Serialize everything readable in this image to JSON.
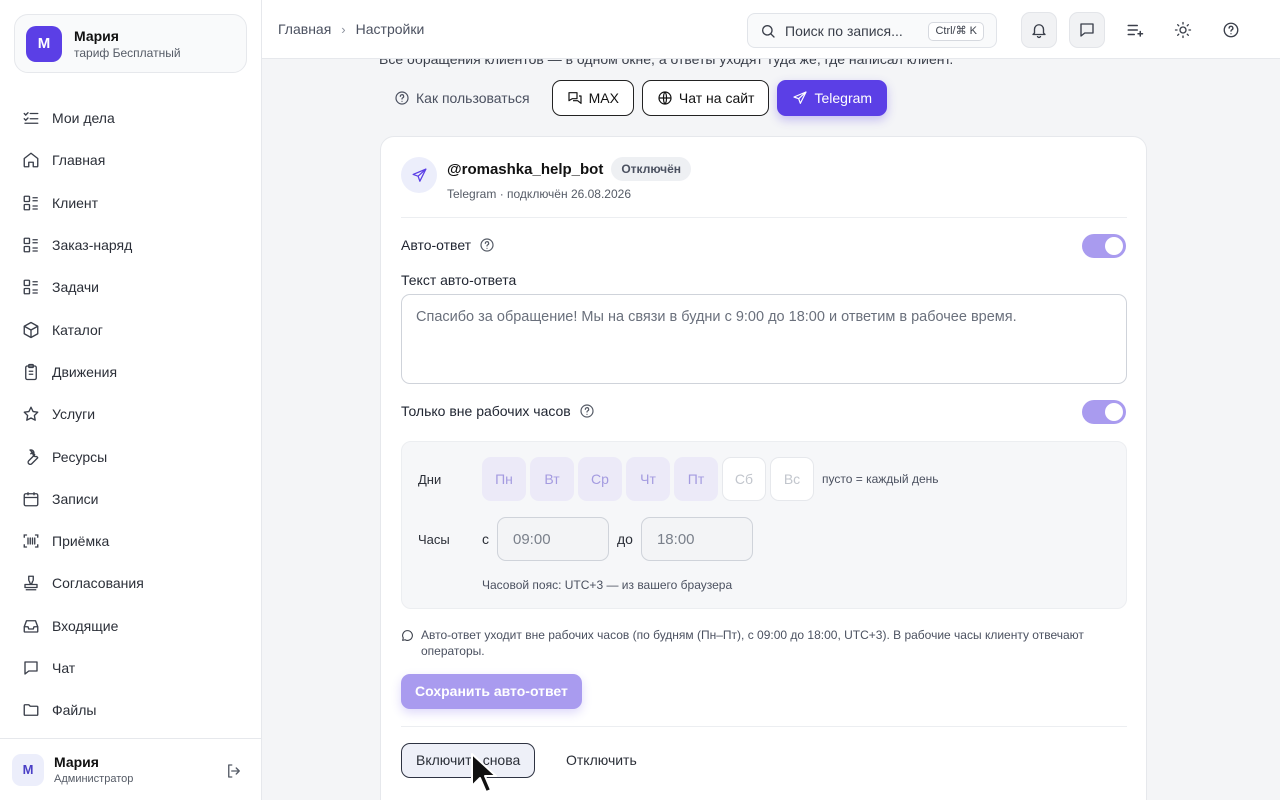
{
  "account": {
    "initial": "М",
    "name": "Мария",
    "plan": "тариф Бесплатный"
  },
  "nav": [
    {
      "label": "Мои дела",
      "icon": "checklist-icon"
    },
    {
      "label": "Главная",
      "icon": "home-icon"
    },
    {
      "label": "Клиент",
      "icon": "list-icon"
    },
    {
      "label": "Заказ-наряд",
      "icon": "list-icon"
    },
    {
      "label": "Задачи",
      "icon": "list-icon"
    },
    {
      "label": "Каталог",
      "icon": "box-icon"
    },
    {
      "label": "Движения",
      "icon": "clipboard-icon"
    },
    {
      "label": "Услуги",
      "icon": "star-icon"
    },
    {
      "label": "Ресурсы",
      "icon": "wrench-icon"
    },
    {
      "label": "Записи",
      "icon": "calendar-icon"
    },
    {
      "label": "Приёмка",
      "icon": "scan-icon"
    },
    {
      "label": "Согласования",
      "icon": "stamp-icon"
    },
    {
      "label": "Входящие",
      "icon": "inbox-icon"
    },
    {
      "label": "Чат",
      "icon": "chat-icon"
    },
    {
      "label": "Файлы",
      "icon": "folder-icon"
    }
  ],
  "footer": {
    "initial": "М",
    "name": "Мария",
    "role": "Администратор"
  },
  "breadcrumb": {
    "home": "Главная",
    "current": "Настройки"
  },
  "search": {
    "placeholder": "Поиск по запися...",
    "shortcut": "Ctrl/⌘ K"
  },
  "header_desc": "Все обращения клиентов — в одном окне, а ответы уходят туда же, где написал клиент.",
  "tabs": {
    "howto": "Как пользоваться",
    "max": "MAX",
    "site": "Чат на сайт",
    "telegram": "Telegram"
  },
  "bot": {
    "name": "@romashka_help_bot",
    "status": "Отключён",
    "meta": "Telegram · подключён 26.08.2026"
  },
  "autoreply": {
    "label": "Авто-ответ",
    "enabled": true,
    "text_label": "Текст авто-ответа",
    "text_placeholder": "Спасибо за обращение! Мы на связи в будни с 9:00 до 18:00 и ответим в рабочее время.",
    "offhours_label": "Только вне рабочих часов",
    "offhours_enabled": true
  },
  "schedule": {
    "days_label": "Дни",
    "days": [
      "Пн",
      "Вт",
      "Ср",
      "Чт",
      "Пт",
      "Сб",
      "Вс"
    ],
    "days_active": [
      true,
      true,
      true,
      true,
      true,
      false,
      false
    ],
    "days_hint": "пусто = каждый день",
    "hours_label": "Часы",
    "from_label": "с",
    "from": "09:00",
    "to_label": "до",
    "to": "18:00",
    "timezone": "Часовой пояс: UTC+3 — из вашего браузера"
  },
  "note": "Авто-ответ уходит вне рабочих часов (по будням (Пн–Пт), с 09:00 до 18:00, UTC+3). В рабочие часы клиенту отвечают операторы.",
  "buttons": {
    "save": "Сохранить авто-ответ",
    "reenable": "Включить снова",
    "disable": "Отключить"
  },
  "colors": {
    "accent": "#5b3fe6",
    "accent_light": "#a99bef"
  }
}
